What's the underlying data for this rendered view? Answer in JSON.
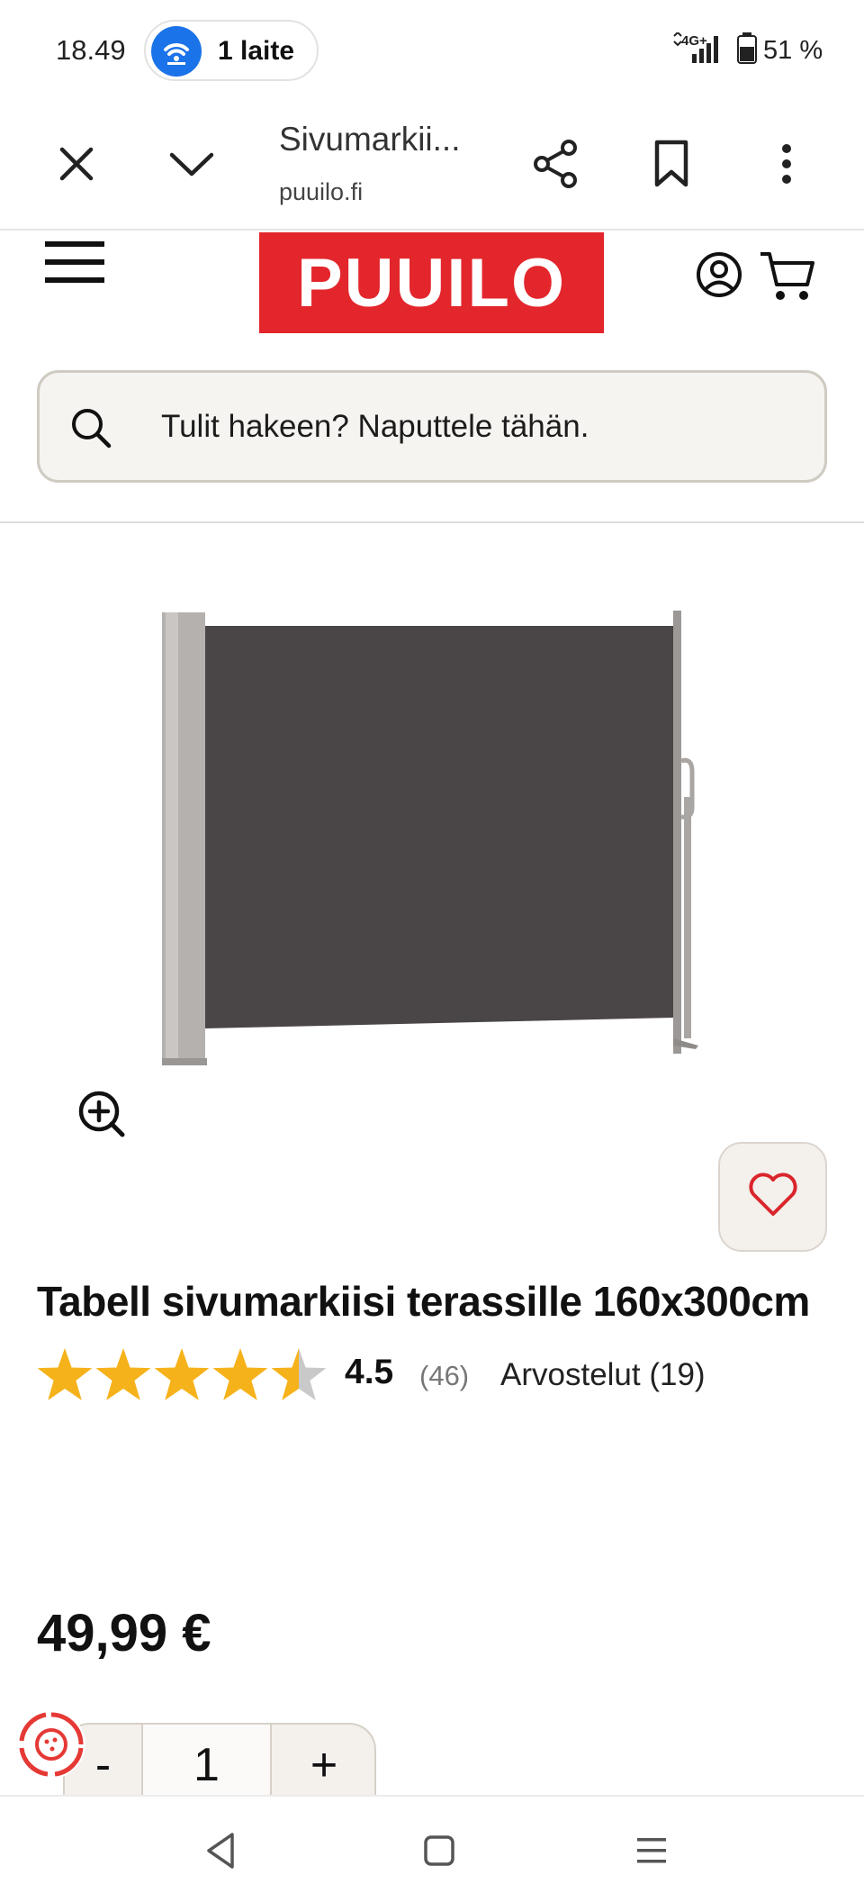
{
  "status_bar": {
    "time": "18.49",
    "hotspot_label": "1 laite",
    "network": "4G+",
    "battery": "51 %"
  },
  "browser": {
    "tab_title": "Sivumarkii...",
    "url": "puuilo.fi"
  },
  "site": {
    "logo": "PUUILO",
    "search_placeholder": "Tulit hakeen? Naputtele tähän.",
    "brand_color": "#e3262c"
  },
  "product": {
    "title": "Tabell sivumarkiisi terassille 160x300cm",
    "rating": "4.5",
    "rating_stars_fraction": 0.9,
    "rating_count": "(46)",
    "reviews_link": "Arvostelut (19)",
    "price": "49,99 €",
    "quantity": "1",
    "qty_minus": "-",
    "qty_plus": "+"
  },
  "icons": {
    "close": "close-icon",
    "collapse": "chevron-down-icon",
    "share": "share-icon",
    "bookmark": "bookmark-icon",
    "menu": "more-vert-icon",
    "hamburger": "hamburger-icon",
    "account": "account-icon",
    "cart": "cart-icon",
    "search": "search-icon",
    "zoom": "zoom-in-icon",
    "favorite": "heart-icon",
    "cookie": "cookie-settings-icon",
    "back": "back-icon",
    "home": "home-icon",
    "recents": "recents-icon"
  }
}
